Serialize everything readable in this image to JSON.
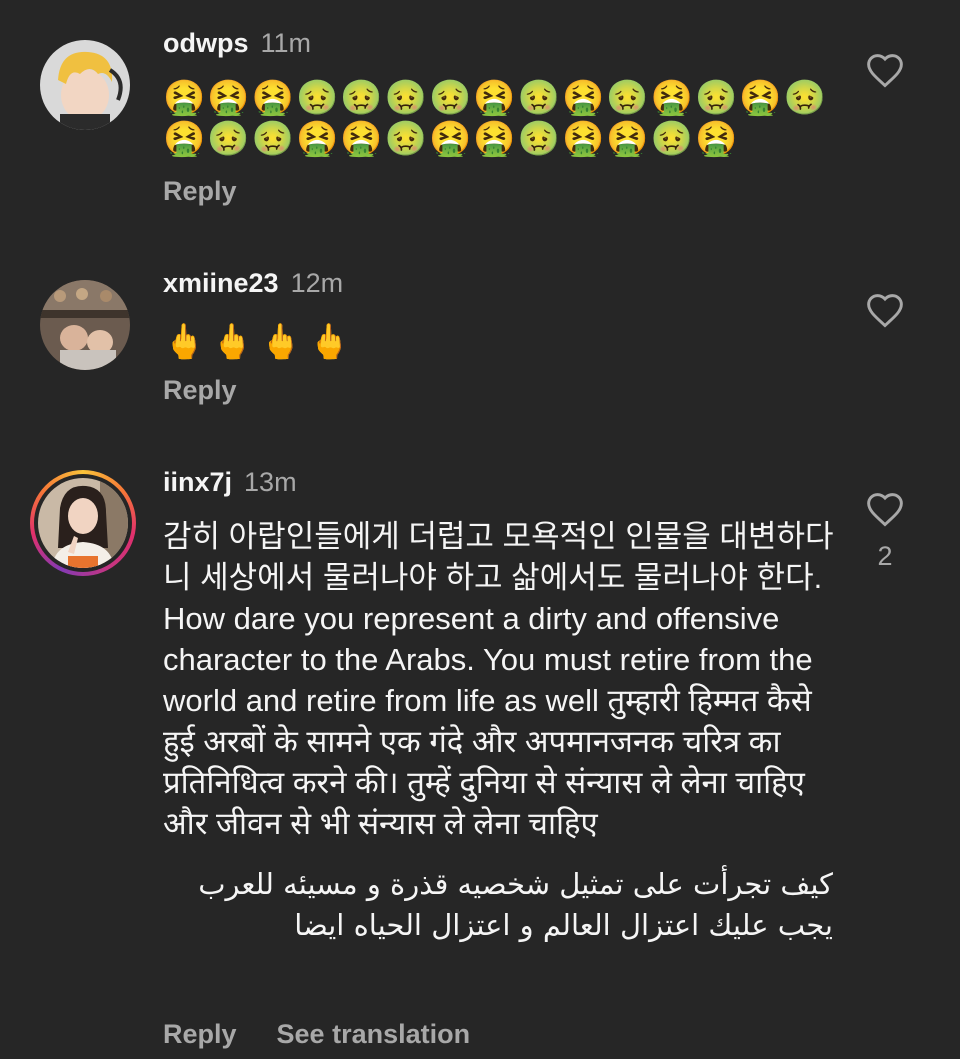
{
  "colors": {
    "background": "#262626",
    "text_primary": "#f5f5f5",
    "text_secondary": "#a8a8a8"
  },
  "icons": {
    "like": "heart-outline-icon"
  },
  "comments": [
    {
      "username": "odwps",
      "time": "11m",
      "emoji_line_1": "🤮🤮🤮🤢🤢🤢🤢🤮🤢🤮🤢🤮🤢🤮🤢",
      "emoji_line_2": "🤮🤢🤢🤮🤮🤢🤮🤮🤢🤮🤮🤢🤮",
      "reply_label": "Reply"
    },
    {
      "username": "xmiine23",
      "time": "12m",
      "emoji_line_1": "🖕🖕🖕🖕",
      "reply_label": "Reply"
    },
    {
      "username": "iinx7j",
      "time": "13m",
      "text": "감히 아랍인들에게 더럽고 모욕적인 인물을 대변하다니 세상에서 물러나야 하고 삶에서도 물러나야 한다.  How dare you represent a dirty and offensive character to the Arabs. You must retire from the world and retire from life as well  तुम्हारी हिम्मत कैसे हुई अरबों के सामने एक गंदे और अपमानजनक चरित्र का प्रतिनिधित्व करने की। तुम्हें दुनिया से संन्यास ले लेना चाहिए और जीवन से भी संन्यास ले लेना चाहिए",
      "text_rtl": "كيف تجرأت على تمثيل شخصيه قذرة و مسيئه للعرب يجب عليك اعتزال العالم و اعتزال الحياه ايضا",
      "like_count": "2",
      "reply_label": "Reply",
      "see_translation_label": "See translation"
    }
  ]
}
